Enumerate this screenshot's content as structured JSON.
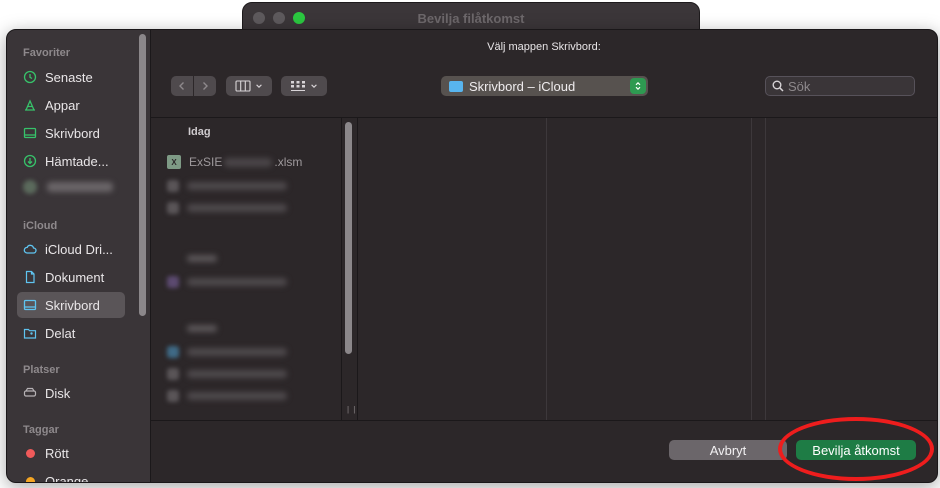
{
  "background_window": {
    "title": "Bevilja filåtkomst"
  },
  "dialog": {
    "prompt": "Välj mappen Skrivbord:",
    "location": "Skrivbord – iCloud",
    "search_placeholder": "Sök",
    "sidebar": {
      "sections": [
        {
          "label": "Favoriter"
        },
        {
          "label": "iCloud"
        },
        {
          "label": "Platser"
        },
        {
          "label": "Taggar"
        }
      ],
      "items": [
        {
          "label": "Senaste",
          "icon": "clock-icon"
        },
        {
          "label": "Appar",
          "icon": "apps-icon"
        },
        {
          "label": "Skrivbord",
          "icon": "desktop-icon"
        },
        {
          "label": "Hämtade...",
          "icon": "download-icon"
        },
        {
          "label": "iCloud Dri...",
          "icon": "cloud-icon"
        },
        {
          "label": "Dokument",
          "icon": "document-icon"
        },
        {
          "label": "Skrivbord",
          "icon": "desktop-icon",
          "selected": true
        },
        {
          "label": "Delat",
          "icon": "shared-folder-icon"
        },
        {
          "label": "Disk",
          "icon": "disk-icon"
        },
        {
          "label": "Rött",
          "icon": "tag-dot-icon",
          "color": "#f05a5a"
        },
        {
          "label": "Orange",
          "icon": "tag-dot-icon",
          "color": "#f5a623"
        }
      ]
    },
    "browser": {
      "group_header": "Idag",
      "file": {
        "name_start": "ExSIE",
        "name_end": ".xlsm"
      }
    },
    "buttons": {
      "cancel": "Avbryt",
      "grant": "Bevilja åtkomst"
    }
  },
  "colors": {
    "accent_green": "#1e7c45",
    "annotation_red": "#ee1d1d",
    "folder_blue": "#58b5ef"
  }
}
